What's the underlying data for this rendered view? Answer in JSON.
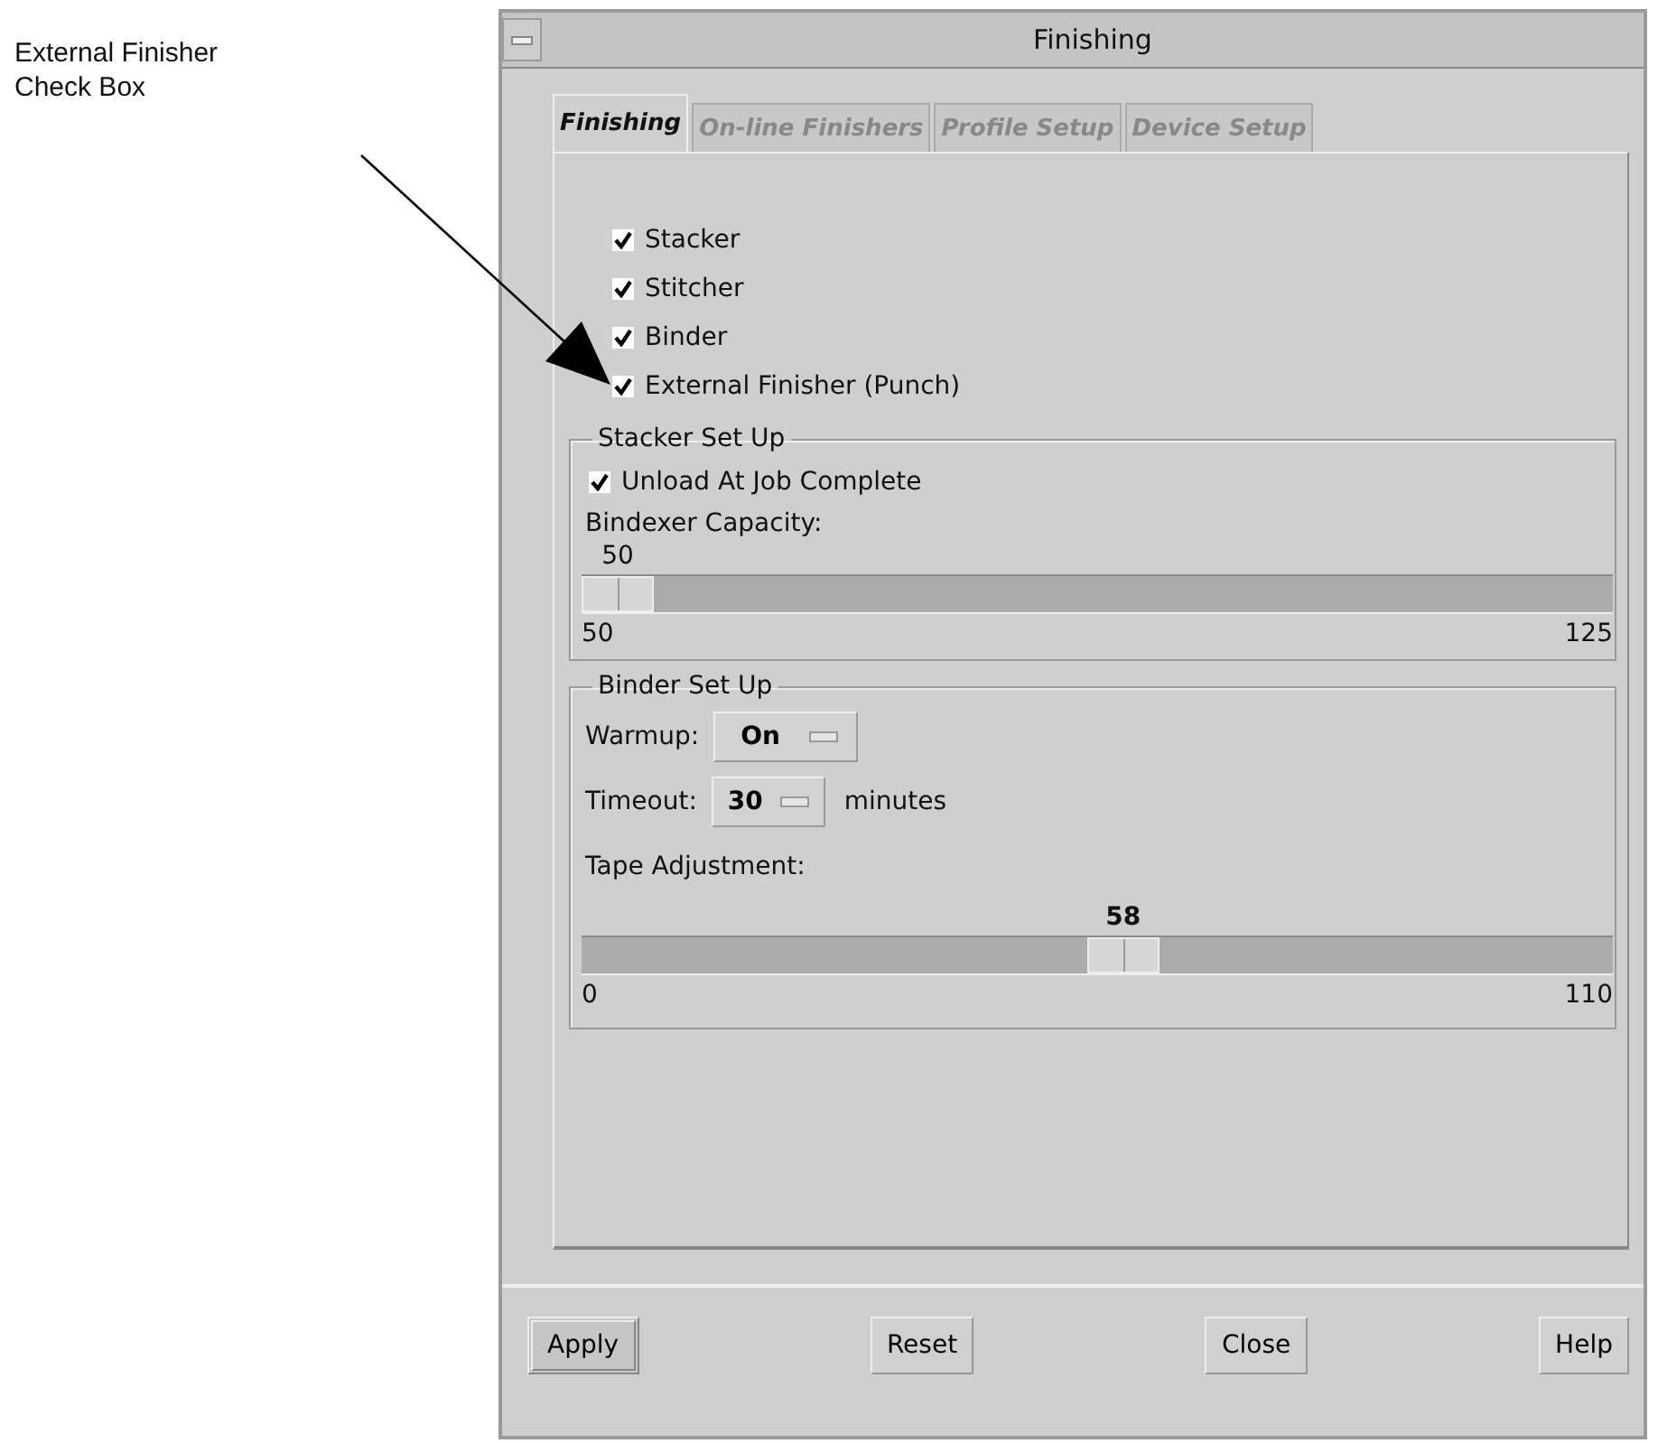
{
  "callout": {
    "text": "External Finisher Check Box"
  },
  "window": {
    "title": "Finishing"
  },
  "tabs": [
    {
      "label": "Finishing",
      "selected": true
    },
    {
      "label": "On-line Finishers",
      "selected": false
    },
    {
      "label": "Profile Setup",
      "selected": false
    },
    {
      "label": "Device Setup",
      "selected": false
    }
  ],
  "finishers": [
    {
      "label": "Stacker",
      "checked": true
    },
    {
      "label": "Stitcher",
      "checked": true
    },
    {
      "label": "Binder",
      "checked": true
    },
    {
      "label": "External Finisher  (Punch)",
      "checked": true
    }
  ],
  "stacker_setup": {
    "title": "Stacker Set Up",
    "unload": {
      "label": "Unload At Job Complete",
      "checked": true
    },
    "capacity": {
      "label": "Bindexer Capacity:",
      "reading": "50",
      "level": 0,
      "min": "50",
      "max": "125"
    }
  },
  "binder_setup": {
    "title": "Binder Set Up",
    "warmup": {
      "label": "Warmup:",
      "value": "On"
    },
    "timeout": {
      "label": "Timeout:",
      "value": "30",
      "unit": "minutes"
    },
    "tape": {
      "label": "Tape Adjustment:",
      "reading": "58",
      "level": 0.527,
      "min": "0",
      "max": "110"
    }
  },
  "buttons": [
    {
      "label": "Apply",
      "default": true
    },
    {
      "label": "Reset",
      "default": false
    },
    {
      "label": "Close",
      "default": false
    },
    {
      "label": "Help",
      "default": false
    }
  ]
}
